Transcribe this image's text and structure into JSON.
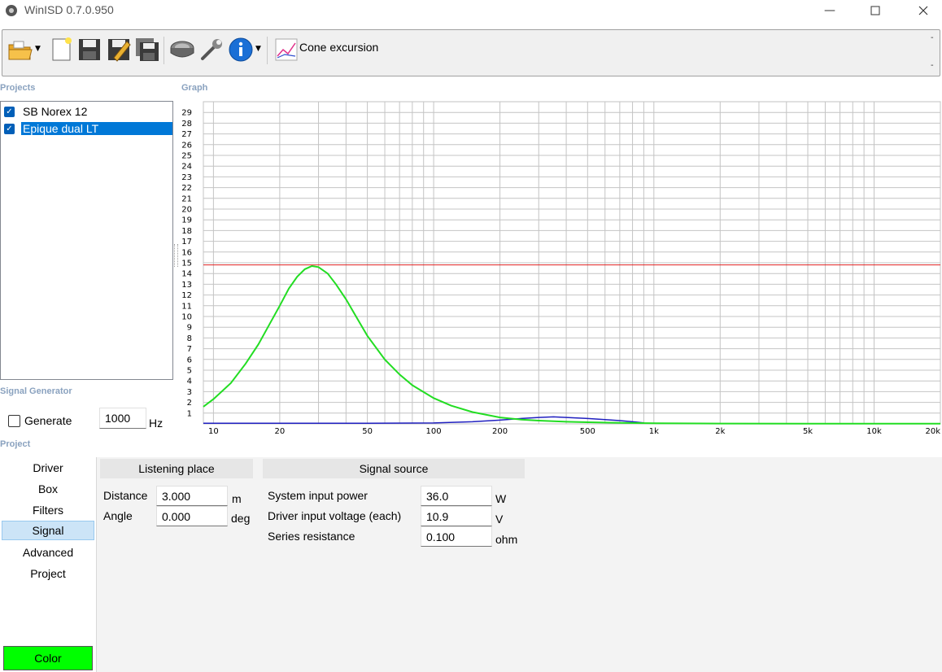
{
  "window": {
    "title": "WinISD 0.7.0.950"
  },
  "toolbar": {
    "graph_selector_label": "Cone excursion",
    "dash_top": "-",
    "dash_bottom": "-",
    "icons": [
      "open-folder-icon",
      "new-document-icon",
      "save-icon",
      "save-as-icon",
      "save-all-icon",
      "driver-icon",
      "wrench-icon",
      "info-icon",
      "cone-excursion-graph-icon"
    ]
  },
  "projects": {
    "header": "Projects",
    "items": [
      {
        "label": "SB Norex 12",
        "checked": true,
        "selected": false
      },
      {
        "label": "Epique dual LT",
        "checked": true,
        "selected": true
      }
    ]
  },
  "signal_generator": {
    "header": "Signal Generator",
    "generate_label": "Generate",
    "frequency_value": "1000",
    "frequency_unit": "Hz"
  },
  "graph": {
    "header": "Graph"
  },
  "chart_data": {
    "type": "line",
    "xscale": "log",
    "xlim": [
      9,
      20000
    ],
    "ylim": [
      0,
      30
    ],
    "grid": true,
    "x_tick_labels": [
      "10",
      "20",
      "50",
      "100",
      "200",
      "500",
      "1k",
      "2k",
      "5k",
      "10k",
      "20k"
    ],
    "x_tick_values": [
      10,
      20,
      50,
      100,
      200,
      500,
      1000,
      2000,
      5000,
      10000,
      20000
    ],
    "y_tick_labels": [
      "1",
      "2",
      "3",
      "4",
      "5",
      "6",
      "7",
      "8",
      "9",
      "10",
      "11",
      "12",
      "13",
      "14",
      "15",
      "16",
      "17",
      "18",
      "19",
      "20",
      "21",
      "22",
      "23",
      "24",
      "25",
      "26",
      "27",
      "28",
      "29"
    ],
    "reference_line": {
      "y": 14.8,
      "color": "#e02020"
    },
    "series": [
      {
        "color": "#22dd22",
        "x": [
          9,
          10,
          12,
          14,
          16,
          18,
          20,
          22,
          24,
          26,
          28,
          30,
          33,
          36,
          40,
          45,
          50,
          60,
          70,
          80,
          100,
          120,
          150,
          200,
          250,
          300,
          400,
          500,
          700,
          1000,
          2000,
          5000,
          10000,
          20000
        ],
        "y": [
          1.6,
          2.3,
          3.8,
          5.6,
          7.4,
          9.3,
          11.0,
          12.6,
          13.7,
          14.4,
          14.7,
          14.6,
          14.0,
          13.0,
          11.6,
          9.8,
          8.2,
          6.0,
          4.6,
          3.6,
          2.4,
          1.7,
          1.1,
          0.6,
          0.4,
          0.3,
          0.2,
          0.15,
          0.1,
          0.05,
          0.03,
          0.02,
          0.02,
          0.02
        ]
      },
      {
        "color": "#2020c0",
        "x": [
          9,
          50,
          100,
          150,
          200,
          250,
          300,
          350,
          400,
          500,
          600,
          700,
          800,
          900
        ],
        "y": [
          0.05,
          0.05,
          0.08,
          0.2,
          0.35,
          0.5,
          0.6,
          0.65,
          0.6,
          0.5,
          0.4,
          0.3,
          0.2,
          0.1
        ]
      }
    ]
  },
  "project": {
    "header": "Project",
    "tabs": [
      {
        "label": "Driver",
        "active": false
      },
      {
        "label": "Box",
        "active": false
      },
      {
        "label": "Filters",
        "active": false
      },
      {
        "label": "Signal",
        "active": true
      },
      {
        "label": "Advanced",
        "active": false
      },
      {
        "label": "Project",
        "active": false
      }
    ],
    "color_button": {
      "label": "Color",
      "color": "#00ff00"
    }
  },
  "listening_place": {
    "header": "Listening place",
    "distance_label": "Distance",
    "distance_value": "3.000",
    "distance_unit": "m",
    "angle_label": "Angle",
    "angle_value": "0.000",
    "angle_unit": "deg"
  },
  "signal_source": {
    "header": "Signal source",
    "power_label": "System input power",
    "power_value": "36.0",
    "power_unit": "W",
    "voltage_label": "Driver input voltage (each)",
    "voltage_value": "10.9",
    "voltage_unit": "V",
    "resistance_label": "Series resistance",
    "resistance_value": "0.100",
    "resistance_unit": "ohm"
  }
}
